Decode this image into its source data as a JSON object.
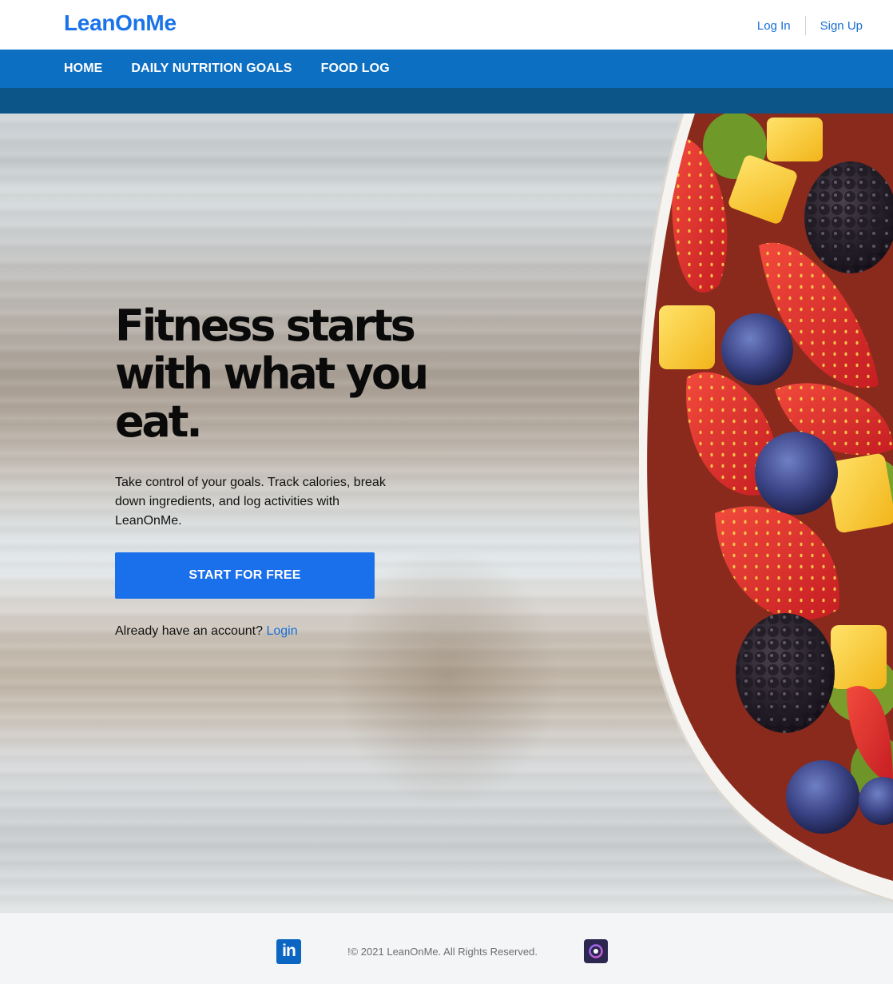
{
  "header": {
    "brand": "LeanOnMe",
    "login_label": "Log In",
    "signup_label": "Sign Up"
  },
  "nav": {
    "items": [
      {
        "label": "HOME"
      },
      {
        "label": "DAILY NUTRITION GOALS"
      },
      {
        "label": "FOOD LOG"
      }
    ]
  },
  "hero": {
    "title_line1": "Fitness starts",
    "title_line2": "with what you",
    "title_line3": "eat.",
    "subtitle": "Take control of your goals. Track calories, break down ingredients, and log activities with LeanOnMe.",
    "cta_label": "START FOR FREE",
    "account_prompt": "Already have an account?",
    "login_link": "Login"
  },
  "footer": {
    "copyright": "!© 2021 LeanOnMe. All Rights Reserved.",
    "linkedin_text": "in",
    "icons": [
      "linkedin-icon",
      "github-icon"
    ]
  },
  "colors": {
    "brand": "#1a73e8",
    "nav_bg": "#0d6fc2",
    "subnav_bg": "#0b5589",
    "cta_bg": "#1a6fea",
    "footer_bg": "#f4f5f6"
  }
}
